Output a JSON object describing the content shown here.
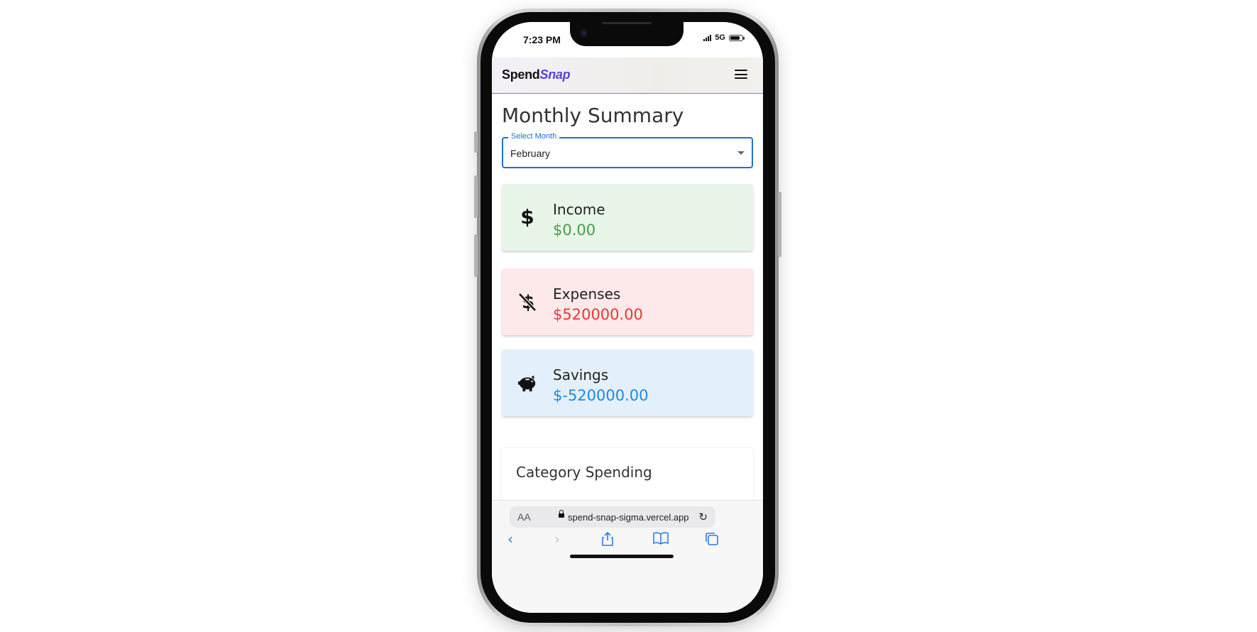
{
  "status_bar": {
    "time": "7:23 PM",
    "network": "5G"
  },
  "app": {
    "logo_part1": "Spend",
    "logo_part2": "Snap",
    "menu_icon": "hamburger-menu-icon"
  },
  "page": {
    "title": "Monthly Summary",
    "month_select": {
      "label": "Select Month",
      "value": "February"
    }
  },
  "cards": {
    "income": {
      "label": "Income",
      "amount": "$0.00",
      "icon": "dollar-icon",
      "color": "#43a047"
    },
    "expenses": {
      "label": "Expenses",
      "amount": "$520000.00",
      "icon": "money-off-icon",
      "color": "#e53935"
    },
    "savings": {
      "label": "Savings",
      "amount": "$-520000.00",
      "icon": "piggy-bank-icon",
      "color": "#1e88e5"
    }
  },
  "category_section": {
    "title": "Category Spending"
  },
  "browser": {
    "aa_label": "AA",
    "url": "spend-snap-sigma.vercel.app",
    "toolbar_icons": [
      "back-icon",
      "forward-icon",
      "share-icon",
      "bookmarks-icon",
      "tabs-icon"
    ],
    "accent": "#2b7de9"
  }
}
